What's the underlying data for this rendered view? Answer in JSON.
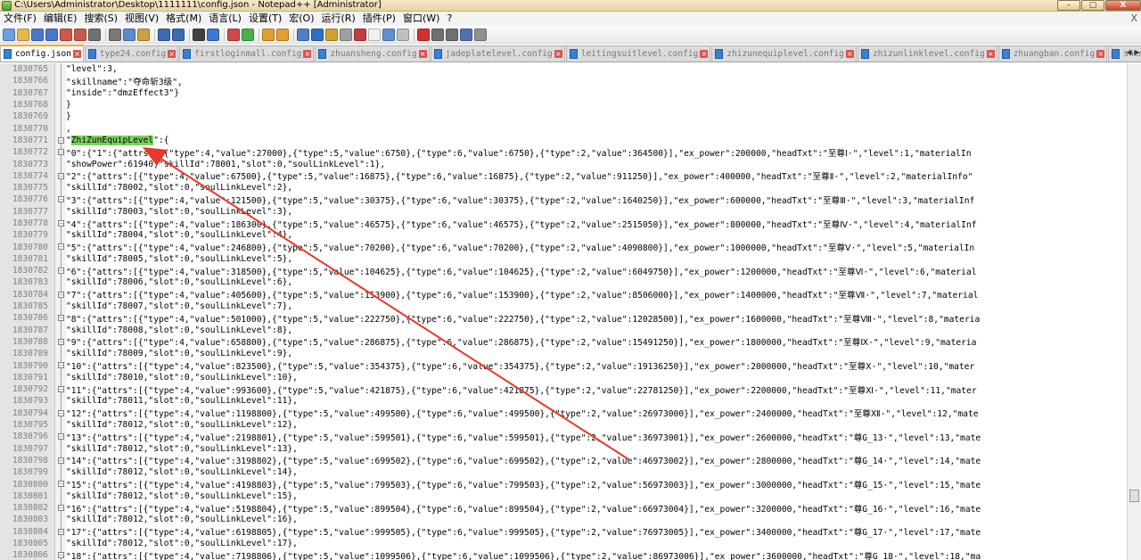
{
  "window": {
    "title": "C:\\Users\\Administrator\\Desktop\\1111111\\config.json - Notepad++ [Administrator]",
    "controls": [
      "–",
      "▢",
      "X"
    ]
  },
  "menu": {
    "items": [
      "文件(F)",
      "编辑(E)",
      "搜索(S)",
      "视图(V)",
      "格式(M)",
      "语言(L)",
      "设置(T)",
      "宏(O)",
      "运行(R)",
      "插件(P)",
      "窗口(W)",
      "?"
    ],
    "close": "X"
  },
  "toolbar": {
    "icons": [
      "new-file-icon",
      "open-file-icon",
      "save-icon",
      "save-all-icon",
      "close-icon",
      "close-all-icon",
      "print-icon",
      "cut-icon",
      "copy-icon",
      "paste-icon",
      "undo-icon",
      "redo-icon",
      "find-icon",
      "replace-icon",
      "zoom-in-icon",
      "zoom-out-icon",
      "sync-v-icon",
      "sync-h-icon",
      "word-wrap-icon",
      "show-all-icon",
      "indent-guide-icon",
      "udl-icon",
      "doc-map-icon",
      "function-list-icon",
      "folder-workspace-icon",
      "monitor-icon",
      "record-macro-icon",
      "stop-macro-icon",
      "play-macro-icon",
      "run-macro-icon",
      "save-macro-icon"
    ]
  },
  "tabs": [
    {
      "label": "config.json",
      "active": true
    },
    {
      "label": "type24.config",
      "active": false
    },
    {
      "label": "firstloginmall.config",
      "active": false
    },
    {
      "label": "zhuansheng.config",
      "active": false
    },
    {
      "label": "jadeplatelevel.config",
      "active": false
    },
    {
      "label": "leitingsuitlevel.config",
      "active": false
    },
    {
      "label": "zhizunequiplevel.config",
      "active": false
    },
    {
      "label": "zhizunlinklevel.config",
      "active": false
    },
    {
      "label": "zhuangban.config",
      "active": false
    },
    {
      "label": "shenhuare",
      "active": false
    }
  ],
  "tab_arrows": [
    "◀",
    "▶"
  ],
  "editor": {
    "lines": [
      {
        "n": "1830765",
        "fold": "line",
        "text": "\"level\":3,"
      },
      {
        "n": "1830766",
        "fold": "line",
        "text": "\"skillname\":\"夺命斩3级\","
      },
      {
        "n": "1830767",
        "fold": "line",
        "text": "\"inside\":\"dmzEffect3\"}"
      },
      {
        "n": "1830768",
        "fold": "line",
        "text": "}"
      },
      {
        "n": "1830769",
        "fold": "line",
        "text": "}"
      },
      {
        "n": "1830770",
        "fold": "line",
        "text": ","
      },
      {
        "n": "1830771",
        "fold": "box",
        "pre": "\"",
        "highlight": "ZhiZunEquipLevel",
        "text": "\":{"
      },
      {
        "n": "1830772",
        "fold": "box",
        "text": "\"0\":{\"1\":{\"attrs\":[{\"type\":4,\"value\":27000},{\"type\":5,\"value\":6750},{\"type\":6,\"value\":6750},{\"type\":2,\"value\":364500}],\"ex_power\":200000,\"headTxt\":\"至尊Ⅰ·\",\"level\":1,\"materialIn"
      },
      {
        "n": "1830773",
        "fold": "line",
        "text": "\"showPower\":61940,\"skillId\":78001,\"slot\":0,\"soulLinkLevel\":1},"
      },
      {
        "n": "1830774",
        "fold": "box",
        "text": "\"2\":{\"attrs\":[{\"type\":4,\"value\":67500},{\"type\":5,\"value\":16875},{\"type\":6,\"value\":16875},{\"type\":2,\"value\":911250}],\"ex_power\":400000,\"headTxt\":\"至尊Ⅱ·\",\"level\":2,\"materialInfo\""
      },
      {
        "n": "1830775",
        "fold": "line",
        "text": "\"skillId\":78002,\"slot\":0,\"soulLinkLevel\":2},"
      },
      {
        "n": "1830776",
        "fold": "box",
        "text": "\"3\":{\"attrs\":[{\"type\":4,\"value\":121500},{\"type\":5,\"value\":30375},{\"type\":6,\"value\":30375},{\"type\":2,\"value\":1640250}],\"ex_power\":600000,\"headTxt\":\"至尊Ⅲ·\",\"level\":3,\"materialInf"
      },
      {
        "n": "1830777",
        "fold": "line",
        "text": "\"skillId\":78003,\"slot\":0,\"soulLinkLevel\":3},"
      },
      {
        "n": "1830778",
        "fold": "box",
        "text": "\"4\":{\"attrs\":[{\"type\":4,\"value\":186300},{\"type\":5,\"value\":46575},{\"type\":6,\"value\":46575},{\"type\":2,\"value\":2515050}],\"ex_power\":800000,\"headTxt\":\"至尊Ⅳ·\",\"level\":4,\"materialInf"
      },
      {
        "n": "1830779",
        "fold": "line",
        "text": "\"skillId\":78004,\"slot\":0,\"soulLinkLevel\":4},"
      },
      {
        "n": "1830780",
        "fold": "box",
        "text": "\"5\":{\"attrs\":[{\"type\":4,\"value\":246800},{\"type\":5,\"value\":70200},{\"type\":6,\"value\":70200},{\"type\":2,\"value\":4090800}],\"ex_power\":1000000,\"headTxt\":\"至尊Ⅴ·\",\"level\":5,\"materialIn"
      },
      {
        "n": "1830781",
        "fold": "line",
        "text": "\"skillId\":78005,\"slot\":0,\"soulLinkLevel\":5},"
      },
      {
        "n": "1830782",
        "fold": "box",
        "text": "\"6\":{\"attrs\":[{\"type\":4,\"value\":318500},{\"type\":5,\"value\":104625},{\"type\":6,\"value\":104625},{\"type\":2,\"value\":6049750}],\"ex_power\":1200000,\"headTxt\":\"至尊Ⅵ·\",\"level\":6,\"material"
      },
      {
        "n": "1830783",
        "fold": "line",
        "text": "\"skillId\":78006,\"slot\":0,\"soulLinkLevel\":6},"
      },
      {
        "n": "1830784",
        "fold": "box",
        "text": "\"7\":{\"attrs\":[{\"type\":4,\"value\":405600},{\"type\":5,\"value\":153900},{\"type\":6,\"value\":153900},{\"type\":2,\"value\":8506000}],\"ex_power\":1400000,\"headTxt\":\"至尊Ⅶ·\",\"level\":7,\"material"
      },
      {
        "n": "1830785",
        "fold": "line",
        "text": "\"skillId\":78007,\"slot\":0,\"soulLinkLevel\":7},"
      },
      {
        "n": "1830786",
        "fold": "box",
        "text": "\"8\":{\"attrs\":[{\"type\":4,\"value\":501000},{\"type\":5,\"value\":222750},{\"type\":6,\"value\":222750},{\"type\":2,\"value\":12028500}],\"ex_power\":1600000,\"headTxt\":\"至尊Ⅷ·\",\"level\":8,\"materia"
      },
      {
        "n": "1830787",
        "fold": "line",
        "text": "\"skillId\":78008,\"slot\":0,\"soulLinkLevel\":8},"
      },
      {
        "n": "1830788",
        "fold": "box",
        "text": "\"9\":{\"attrs\":[{\"type\":4,\"value\":658800},{\"type\":5,\"value\":286875},{\"type\":6,\"value\":286875},{\"type\":2,\"value\":15491250}],\"ex_power\":1800000,\"headTxt\":\"至尊Ⅸ·\",\"level\":9,\"materia"
      },
      {
        "n": "1830789",
        "fold": "line",
        "text": "\"skillId\":78009,\"slot\":0,\"soulLinkLevel\":9},"
      },
      {
        "n": "1830790",
        "fold": "box",
        "text": "\"10\":{\"attrs\":[{\"type\":4,\"value\":823500},{\"type\":5,\"value\":354375},{\"type\":6,\"value\":354375},{\"type\":2,\"value\":19136250}],\"ex_power\":2000000,\"headTxt\":\"至尊Ⅹ·\",\"level\":10,\"mater"
      },
      {
        "n": "1830791",
        "fold": "line",
        "text": "\"skillId\":78010,\"slot\":0,\"soulLinkLevel\":10},"
      },
      {
        "n": "1830792",
        "fold": "box",
        "text": "\"11\":{\"attrs\":[{\"type\":4,\"value\":993600},{\"type\":5,\"value\":421875},{\"type\":6,\"value\":421875},{\"type\":2,\"value\":22781250}],\"ex_power\":2200000,\"headTxt\":\"至尊Ⅺ·\",\"level\":11,\"mater"
      },
      {
        "n": "1830793",
        "fold": "line",
        "text": "\"skillId\":78011,\"slot\":0,\"soulLinkLevel\":11},"
      },
      {
        "n": "1830794",
        "fold": "box",
        "text": "\"12\":{\"attrs\":[{\"type\":4,\"value\":1198800},{\"type\":5,\"value\":499500},{\"type\":6,\"value\":499500},{\"type\":2,\"value\":26973000}],\"ex_power\":2400000,\"headTxt\":\"至尊Ⅻ·\",\"level\":12,\"mate"
      },
      {
        "n": "1830795",
        "fold": "line",
        "text": "\"skillId\":78012,\"slot\":0,\"soulLinkLevel\":12},"
      },
      {
        "n": "1830796",
        "fold": "box",
        "text": "\"13\":{\"attrs\":[{\"type\":4,\"value\":2198801},{\"type\":5,\"value\":599501},{\"type\":6,\"value\":599501},{\"type\":2,\"value\":36973001}],\"ex_power\":2600000,\"headTxt\":\"尊G_13·\",\"level\":13,\"mate"
      },
      {
        "n": "1830797",
        "fold": "line",
        "text": "\"skillId\":78012,\"slot\":0,\"soulLinkLevel\":13},"
      },
      {
        "n": "1830798",
        "fold": "box",
        "text": "\"14\":{\"attrs\":[{\"type\":4,\"value\":3198802},{\"type\":5,\"value\":699502},{\"type\":6,\"value\":699502},{\"type\":2,\"value\":46973002}],\"ex_power\":2800000,\"headTxt\":\"尊G_14·\",\"level\":14,\"mate"
      },
      {
        "n": "1830799",
        "fold": "line",
        "text": "\"skillId\":78012,\"slot\":0,\"soulLinkLevel\":14},"
      },
      {
        "n": "1830800",
        "fold": "box",
        "text": "\"15\":{\"attrs\":[{\"type\":4,\"value\":4198803},{\"type\":5,\"value\":799503},{\"type\":6,\"value\":799503},{\"type\":2,\"value\":56973003}],\"ex_power\":3000000,\"headTxt\":\"尊G_15·\",\"level\":15,\"mate"
      },
      {
        "n": "1830801",
        "fold": "line",
        "text": "\"skillId\":78012,\"slot\":0,\"soulLinkLevel\":15},"
      },
      {
        "n": "1830802",
        "fold": "box",
        "text": "\"16\":{\"attrs\":[{\"type\":4,\"value\":5198804},{\"type\":5,\"value\":899504},{\"type\":6,\"value\":899504},{\"type\":2,\"value\":66973004}],\"ex_power\":3200000,\"headTxt\":\"尊G_16·\",\"level\":16,\"mate"
      },
      {
        "n": "1830803",
        "fold": "line",
        "text": "\"skillId\":78012,\"slot\":0,\"soulLinkLevel\":16},"
      },
      {
        "n": "1830804",
        "fold": "box",
        "text": "\"17\":{\"attrs\":[{\"type\":4,\"value\":6198805},{\"type\":5,\"value\":999505},{\"type\":6,\"value\":999505},{\"type\":2,\"value\":76973005}],\"ex_power\":3400000,\"headTxt\":\"尊G_17·\",\"level\":17,\"mate"
      },
      {
        "n": "1830805",
        "fold": "line",
        "text": "\"skillId\":78012,\"slot\":0,\"soulLinkLevel\":17},"
      },
      {
        "n": "1830806",
        "fold": "box",
        "text": "\"18\":{\"attrs\":[{\"type\":4,\"value\":7198806},{\"type\":5,\"value\":1099506},{\"type\":6,\"value\":1099506},{\"type\":2,\"value\":86973006}],\"ex_power\":3600000,\"headTxt\":\"尊G_18·\",\"level\":18,\"ma"
      }
    ]
  },
  "colors": {
    "highlight": "#7ad35e",
    "annotation_arrow": "#e8372c",
    "active_tab_accent": "#f5a623"
  }
}
